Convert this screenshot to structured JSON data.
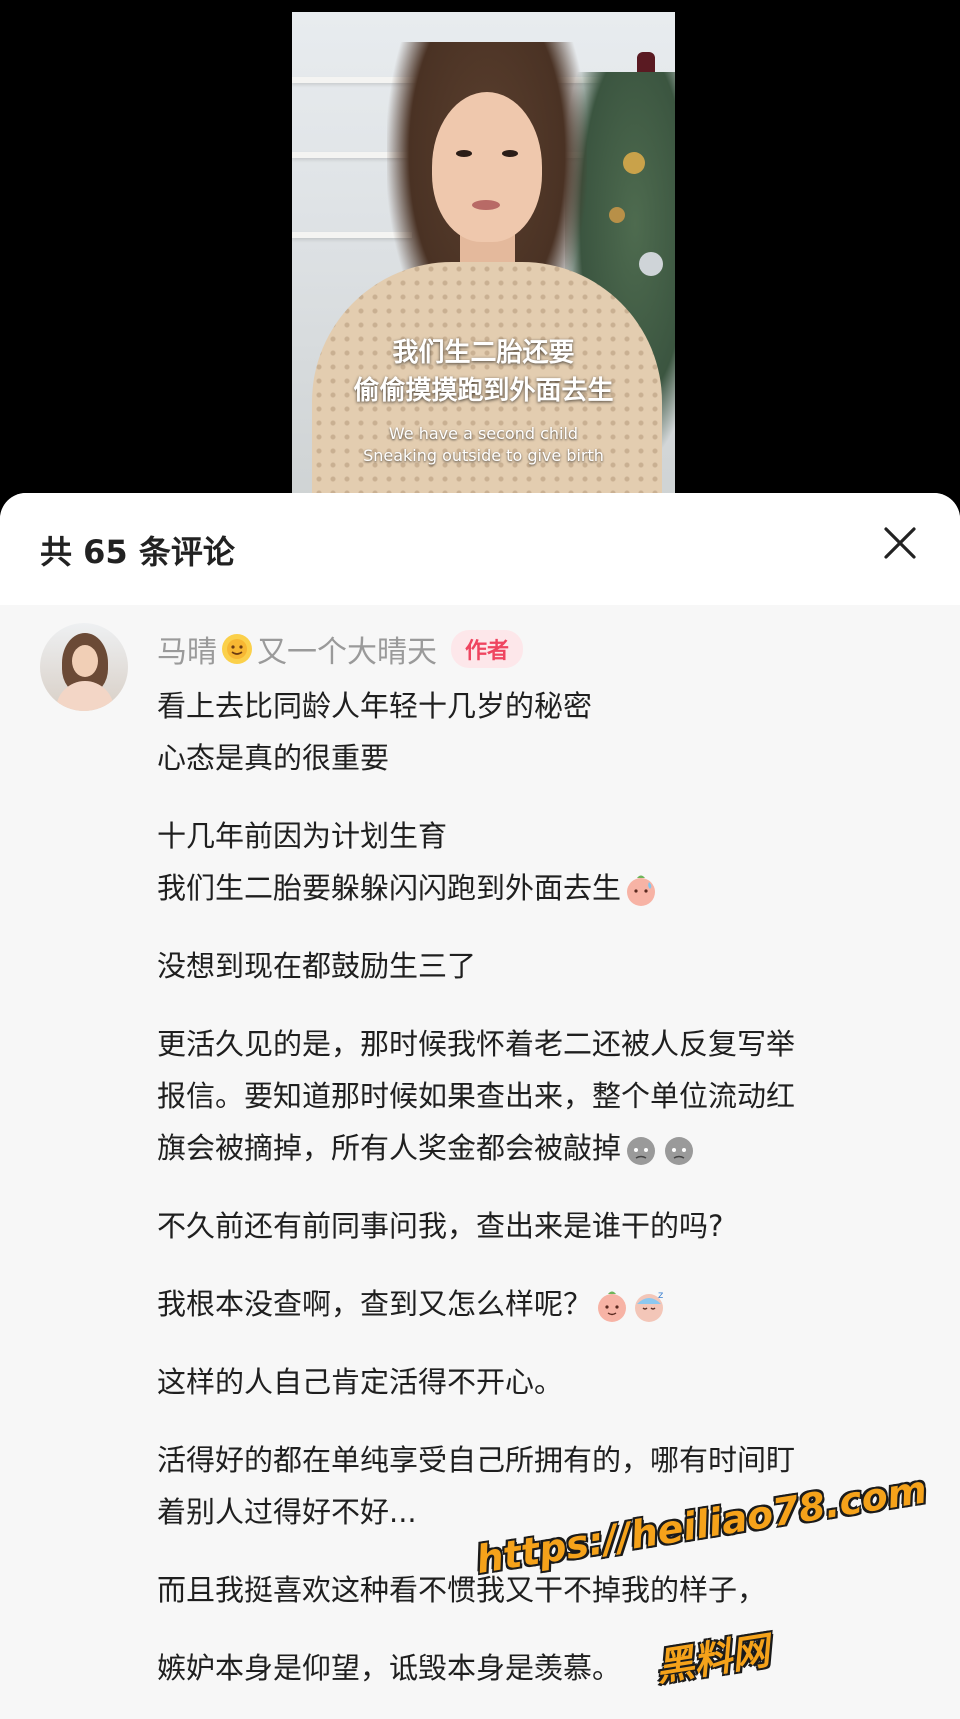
{
  "video": {
    "subtitle_cn_line1": "我们生二胎还要",
    "subtitle_cn_line2": "偷偷摸摸跑到外面去生",
    "subtitle_en_line1": "We have a second child",
    "subtitle_en_line2": "Sneaking outside to give birth"
  },
  "comments_panel": {
    "title": "共 65 条评论",
    "close_icon": "close-icon"
  },
  "comment": {
    "author": "马晴",
    "author_suffix": "又一个大晴天",
    "badge": "作者",
    "lines": [
      "看上去比同龄人年轻十几岁的秘密",
      "心态是真的很重要",
      "十几年前因为计划生育",
      "我们生二胎要躲躲闪闪跑到外面去生",
      "没想到现在都鼓励生三了",
      "更活久见的是，那时候我怀着老二还被人反复写举",
      "报信。要知道那时候如果查出来，整个单位流动红",
      "旗会被摘掉，所有人奖金都会被敲掉",
      "不久前还有前同事问我，查出来是谁干的吗?",
      "我根本没查啊，查到又怎么样呢？",
      "这样的人自己肯定活得不开心。",
      "活得好的都在单纯享受自己所拥有的，哪有时间盯",
      "着别人过得好不好...",
      "而且我挺喜欢这种看不惯我又干不掉我的样子，",
      "嫉妒本身是仰望，诋毁本身是羡慕。"
    ]
  },
  "watermark": {
    "url": "https://heiliao78.com",
    "name": "黑料网"
  },
  "colors": {
    "badge_bg": "#fde7ea",
    "badge_text": "#ef4560",
    "watermark": "#f5a21a"
  }
}
